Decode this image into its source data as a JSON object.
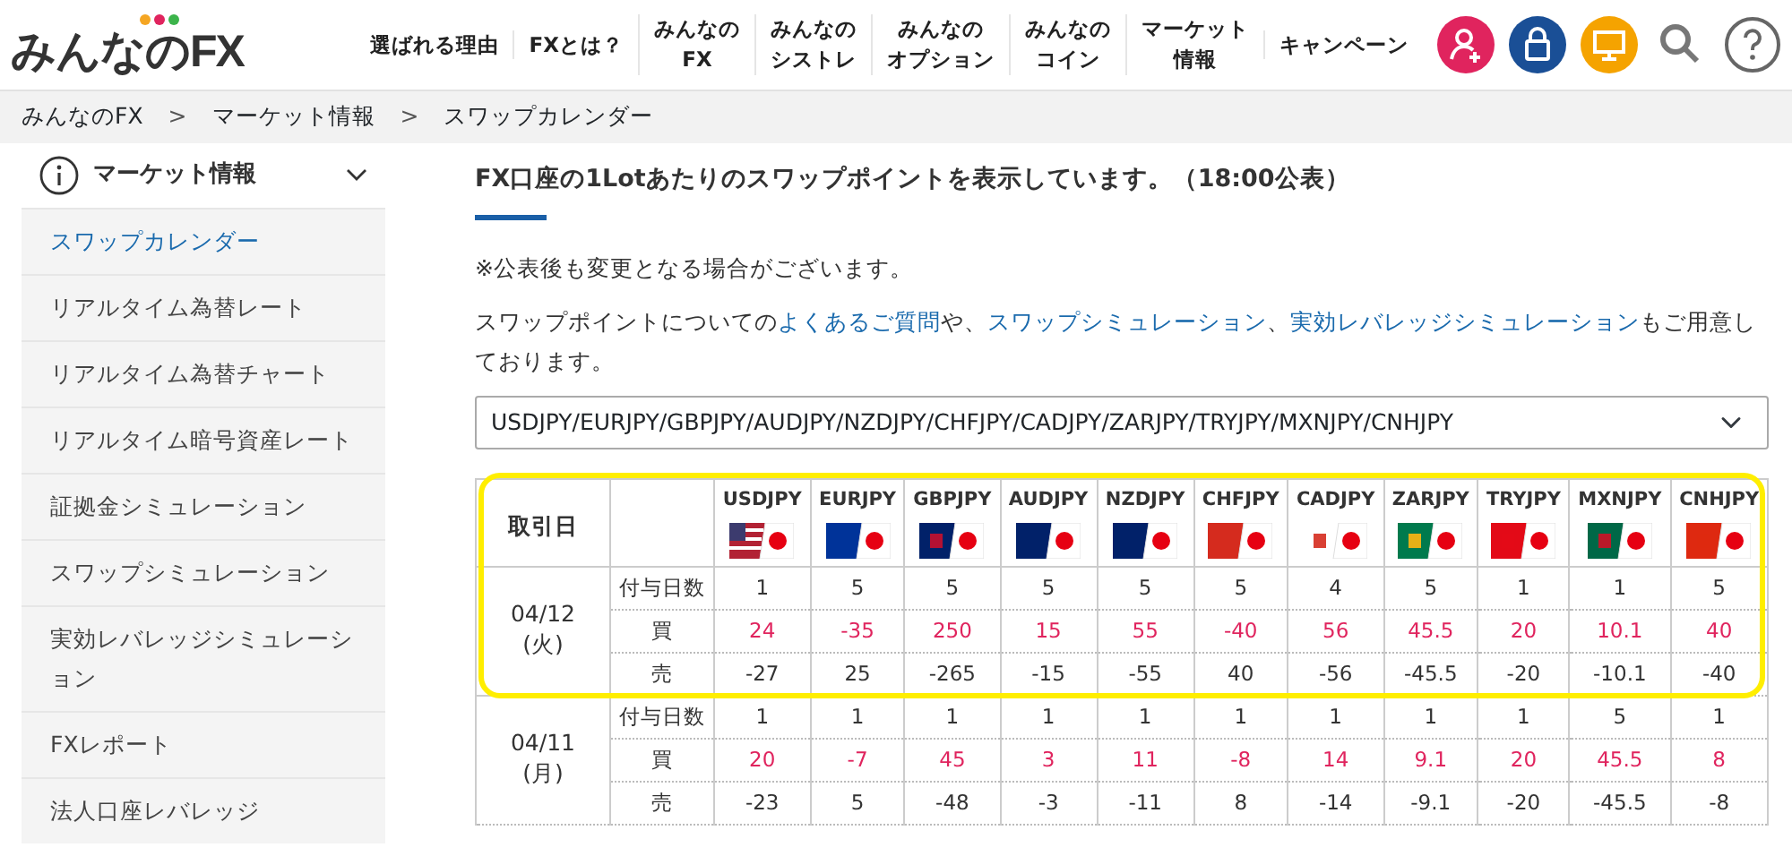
{
  "logo": {
    "text": "みんなのFX"
  },
  "nav": [
    {
      "lines": [
        "選ばれる理由"
      ]
    },
    {
      "lines": [
        "FXとは？"
      ]
    },
    {
      "lines": [
        "みんなの",
        "FX"
      ]
    },
    {
      "lines": [
        "みんなの",
        "シストレ"
      ]
    },
    {
      "lines": [
        "みんなの",
        "オプション"
      ]
    },
    {
      "lines": [
        "みんなの",
        "コイン"
      ]
    },
    {
      "lines": [
        "マーケット",
        "情報"
      ]
    },
    {
      "lines": [
        "キャンペーン"
      ]
    }
  ],
  "header_icons": [
    {
      "kind": "account"
    },
    {
      "kind": "lock"
    },
    {
      "kind": "monitor"
    },
    {
      "kind": "search"
    },
    {
      "kind": "help"
    }
  ],
  "breadcrumb": [
    {
      "label": "みんなのFX"
    },
    {
      "separator": ">",
      "label": "マーケット情報"
    },
    {
      "separator": ">",
      "label": "スワップカレンダー"
    }
  ],
  "sidebar": {
    "title": "マーケット情報",
    "expanded": true,
    "items": [
      {
        "label": "スワップカレンダー",
        "selected": true
      },
      {
        "label": "リアルタイム為替レート",
        "selected": false
      },
      {
        "label": "リアルタイム為替チャート",
        "selected": false
      },
      {
        "label": "リアルタイム暗号資産レート",
        "selected": false
      },
      {
        "label": "証拠金シミュレーション",
        "selected": false
      },
      {
        "label": "スワップシミュレーション",
        "selected": false
      },
      {
        "label": "実効レバレッジシミュレーション",
        "selected": false
      },
      {
        "label": "FXレポート",
        "selected": false
      },
      {
        "label": "法人口座レバレッジ",
        "selected": false
      }
    ]
  },
  "heading": "FX口座の1Lotあたりのスワップポイントを表示しています。（18:00公表）",
  "note": "※公表後も変更となる場合がございます。",
  "intro": [
    {
      "text": "スワップポイントについての",
      "link": false
    },
    {
      "text": "よくあるご質問",
      "link": true
    },
    {
      "text": "や、",
      "link": false
    },
    {
      "text": "スワップシミュレーション",
      "link": true
    },
    {
      "text": "、",
      "link": false
    },
    {
      "text": "実効レバレッジシミュレーション",
      "link": true
    },
    {
      "text": "もご用意しております。",
      "link": false
    }
  ],
  "pair_select": {
    "value": "USDJPY/EURJPY/GBPJPY/AUDJPY/NZDJPY/CHFJPY/CADJPY/ZARJPY/TRYJPY/MXNJPY/CNHJPY"
  },
  "table": {
    "date_header": "取引日",
    "pairs": [
      "USDJPY",
      "EURJPY",
      "GBPJPY",
      "AUDJPY",
      "NZDJPY",
      "CHFJPY",
      "CADJPY",
      "ZARJPY",
      "TRYJPY",
      "MXNJPY",
      "CNHJPY"
    ],
    "groups": [
      {
        "date": "04/12",
        "weekday": "(火)",
        "highlighted": true,
        "rows": [
          {
            "label": "付与日数",
            "kind": "days",
            "values": [
              "1",
              "5",
              "5",
              "5",
              "5",
              "5",
              "4",
              "5",
              "1",
              "1",
              "5"
            ]
          },
          {
            "label": "買",
            "kind": "buy",
            "values": [
              "24",
              "-35",
              "250",
              "15",
              "55",
              "-40",
              "56",
              "45.5",
              "20",
              "10.1",
              "40"
            ]
          },
          {
            "label": "売",
            "kind": "sell",
            "values": [
              "-27",
              "25",
              "-265",
              "-15",
              "-55",
              "40",
              "-56",
              "-45.5",
              "-20",
              "-10.1",
              "-40"
            ]
          }
        ]
      },
      {
        "date": "04/11",
        "weekday": "(月)",
        "highlighted": false,
        "rows": [
          {
            "label": "付与日数",
            "kind": "days",
            "values": [
              "1",
              "1",
              "1",
              "1",
              "1",
              "1",
              "1",
              "1",
              "1",
              "5",
              "1"
            ]
          },
          {
            "label": "買",
            "kind": "buy",
            "values": [
              "20",
              "-7",
              "45",
              "3",
              "11",
              "-8",
              "14",
              "9.1",
              "20",
              "45.5",
              "8"
            ]
          },
          {
            "label": "売",
            "kind": "sell",
            "values": [
              "-23",
              "5",
              "-48",
              "-3",
              "-11",
              "8",
              "-14",
              "-9.1",
              "-20",
              "-45.5",
              "-8"
            ]
          }
        ]
      }
    ]
  }
}
